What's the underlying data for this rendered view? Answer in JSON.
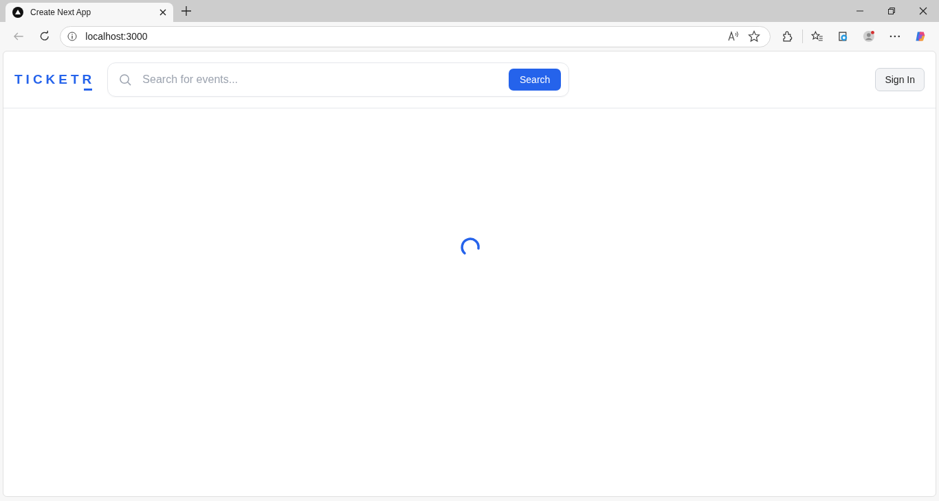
{
  "browser": {
    "tab_title": "Create Next App",
    "url": "localhost:3000"
  },
  "header": {
    "logo": "TICKETR",
    "search": {
      "placeholder": "Search for events...",
      "button": "Search"
    },
    "sign_in": "Sign In"
  }
}
